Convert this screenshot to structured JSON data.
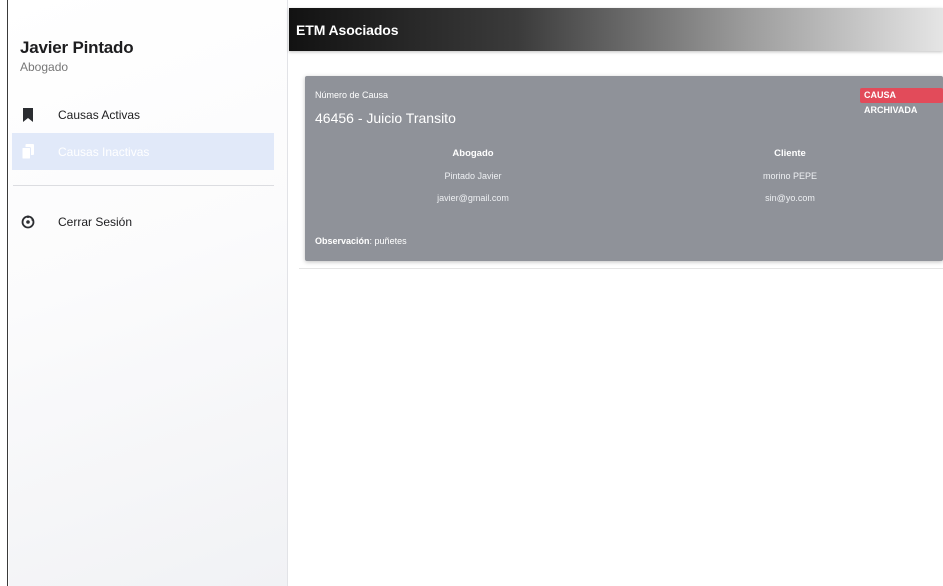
{
  "user": {
    "name": "Javier Pintado",
    "role": "Abogado"
  },
  "nav": {
    "active_causes": "Causas Activas",
    "inactive_causes": "Causas Inactivas",
    "logout": "Cerrar Sesión"
  },
  "header": {
    "brand": "ETM Asociados"
  },
  "case": {
    "number_label": "Número de Causa",
    "title": "46456 - Juicio Transito",
    "badge": "CAUSA ARCHIVADA",
    "lawyer": {
      "heading": "Abogado",
      "name": "Pintado Javier",
      "email": "javier@gmail.com"
    },
    "client": {
      "heading": "Cliente",
      "name": "morino PEPE",
      "email": "sin@yo.com"
    },
    "observation_label": "Observación",
    "observation_value": "puñetes"
  },
  "colors": {
    "card_bg": "#8f9299",
    "badge_bg": "#e24b5a",
    "nav_selected_bg": "#e1e9f9",
    "topbar_start": "#121212",
    "topbar_end": "#e5e5e5"
  },
  "icons": {
    "active_causes": "bookmark-icon",
    "inactive_causes": "document-copy-icon",
    "logout": "power-icon"
  }
}
